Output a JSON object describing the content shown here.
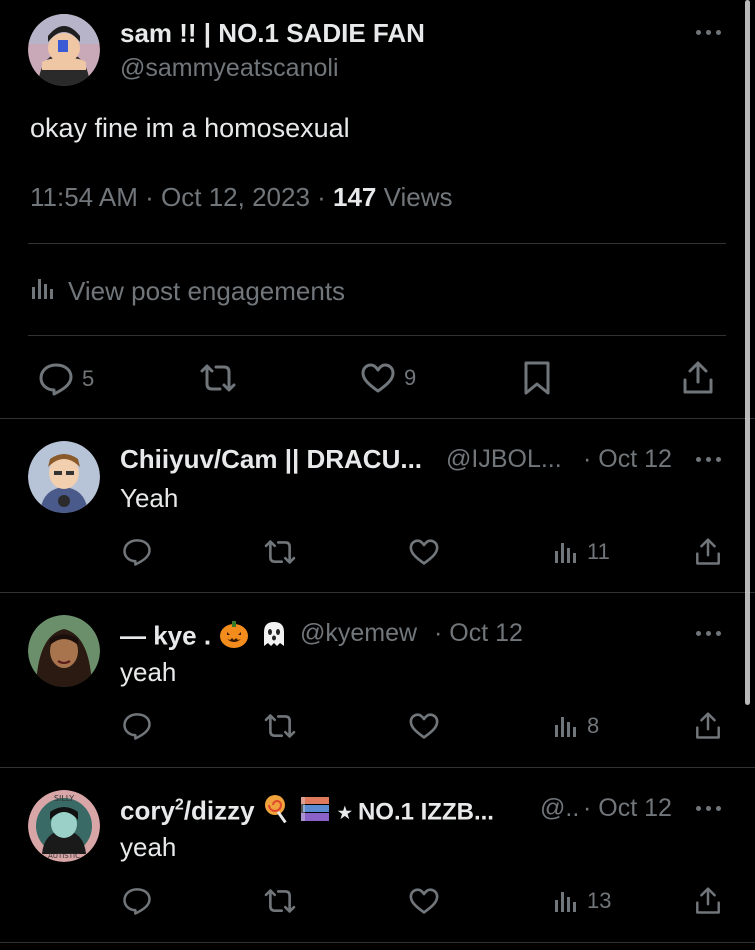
{
  "main_post": {
    "display_name": "sam !! | NO.1 SADIE FAN",
    "handle": "@sammyeatscanoli",
    "text": "okay fine im a homosexual",
    "time": "11:54 AM · Oct 12, 2023 · ",
    "views_count": "147",
    "views_label": " Views",
    "engagements_label": "View post engagements",
    "replies": "5",
    "likes": "9"
  },
  "replies": [
    {
      "display_name": "Chiiyuv/Cam || DRACU...",
      "handle": "@IJBOL...",
      "date": "· Oct 12",
      "text": "Yeah",
      "views": "11"
    },
    {
      "display_name": "— kye .",
      "handle": "@kyemew",
      "date": "· Oct 12",
      "text": "yeah",
      "views": "8"
    },
    {
      "display_name_pre": "cory",
      "display_name_sup": "2",
      "display_name_post": "/dizzy",
      "display_name_tail": "⭑ NO.1 IZZB...",
      "handle": "@..",
      "date": "· Oct 12",
      "text": "yeah",
      "views": "13"
    }
  ],
  "icons": {
    "reply": "speech-bubble-icon",
    "repost": "repost-icon",
    "like": "heart-icon",
    "bookmark": "bookmark-icon",
    "share": "share-icon",
    "views": "bar-chart-icon",
    "more": "more-dots-icon"
  },
  "colors": {
    "background": "#000000",
    "text": "#e7e9ea",
    "secondary": "#71767b",
    "divider": "#2f3336"
  }
}
